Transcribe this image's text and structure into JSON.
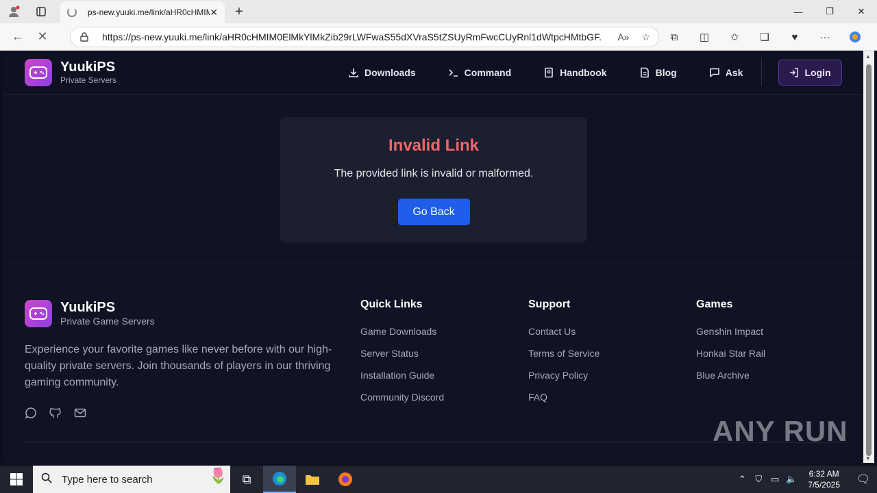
{
  "browser": {
    "tab_title": "ps-new.yuuki.me/link/aHR0cHMIM",
    "url": "https://ps-new.yuuki.me/link/aHR0cHMIM0ElMkYlMkZib29rLWFwaS55dXVraS5tZSUyRmFwcCUyRnl1dWtpcHMtbGF..."
  },
  "site": {
    "brand_name": "YuukiPS",
    "brand_sub": "Private Servers",
    "nav": [
      {
        "label": "Downloads",
        "icon": "download-icon"
      },
      {
        "label": "Command",
        "icon": "terminal-icon"
      },
      {
        "label": "Handbook",
        "icon": "book-icon"
      },
      {
        "label": "Blog",
        "icon": "document-icon"
      },
      {
        "label": "Ask",
        "icon": "chat-icon"
      }
    ],
    "login_label": "Login"
  },
  "error": {
    "title": "Invalid Link",
    "message": "The provided link is invalid or malformed.",
    "button": "Go Back"
  },
  "footer": {
    "brand_name": "YuukiPS",
    "brand_sub": "Private Game Servers",
    "description": "Experience your favorite games like never before with our high-quality private servers. Join thousands of players in our thriving gaming community.",
    "columns": [
      {
        "title": "Quick Links",
        "links": [
          "Game Downloads",
          "Server Status",
          "Installation Guide",
          "Community Discord"
        ]
      },
      {
        "title": "Support",
        "links": [
          "Contact Us",
          "Terms of Service",
          "Privacy Policy",
          "FAQ"
        ]
      },
      {
        "title": "Games",
        "links": [
          "Genshin Impact",
          "Honkai Star Rail",
          "Blue Archive"
        ]
      }
    ],
    "watermark": "ANY RUN"
  },
  "taskbar": {
    "search_placeholder": "Type here to search",
    "time": "6:32 AM",
    "date": "7/5/2025"
  },
  "colors": {
    "accent_error": "#f06767",
    "button_blue": "#1e5ee8",
    "logo_gradient_start": "#d046c8",
    "logo_gradient_end": "#8b3fe6"
  }
}
